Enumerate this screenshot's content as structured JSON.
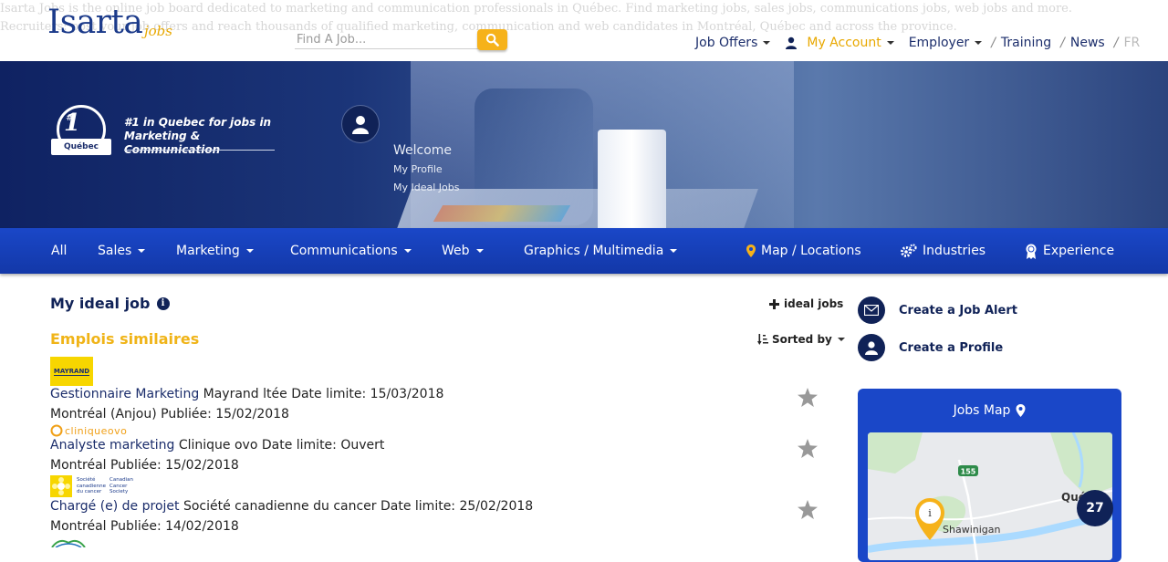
{
  "header": {
    "ghost_text_1": "Isarta Jobs is the online job board dedicated to marketing and communication professionals in Québec. Find marketing jobs, sales jobs, communications jobs, web jobs and more.",
    "ghost_text_2": "Recruiters: post your job offers and reach thousands of qualified marketing, communication and web candidates in Montréal, Québec and across the province.",
    "logo": "Isarta",
    "logo_sub": "jobs",
    "search_placeholder": "Find A Job...",
    "nav": {
      "job_offers": "Job Offers",
      "my_account": "My Account",
      "employer": "Employer",
      "training": "Training",
      "news": "News",
      "lang": "FR",
      "slash": "/"
    }
  },
  "hero": {
    "badge_hash": "#",
    "badge_number": "1",
    "badge_ribbon": "Québec",
    "tagline": "#1 in Quebec for jobs in Marketing & Communication",
    "welcome": "Welcome",
    "my_profile": "My Profile",
    "my_ideal_jobs": "My Ideal Jobs"
  },
  "main_nav": {
    "all": "All",
    "sales": "Sales",
    "marketing": "Marketing",
    "communications": "Communications",
    "web": "Web",
    "graphics": "Graphics / Multimedia",
    "map": "Map / Locations",
    "industries": "Industries",
    "experience": "Experience"
  },
  "content": {
    "my_ideal_job": "My ideal job",
    "info": "i",
    "similar_jobs": "Emplois similaires",
    "add_ideal_jobs": "ideal jobs",
    "sorted_by": "Sorted by"
  },
  "jobs": [
    {
      "logo_text": "MAYRAND",
      "title": "Gestionnaire Marketing",
      "details": " Mayrand ltée Date limite: 15/03/2018",
      "location": "Montréal (Anjou) Publiée: 15/02/2018"
    },
    {
      "logo_text": "cliniqueovo",
      "title": "Analyste marketing",
      "details": " Clinique ovo Date limite: Ouvert",
      "location": "Montréal Publiée: 15/02/2018"
    },
    {
      "logo_text_fr": "Société canadienne du cancer",
      "logo_text_en": "Canadian Cancer Society",
      "title": "Chargé (e) de projet",
      "details": " Société canadienne du cancer Date limite: 25/02/2018",
      "location": "Montréal Publiée: 14/02/2018"
    }
  ],
  "sidebar": {
    "create_alert": "Create a Job Alert",
    "create_profile": "Create a Profile",
    "jobs_map": "Jobs Map",
    "map_labels": {
      "route": "155",
      "city": "Shawinigan",
      "city2": "Qué",
      "marker": "i",
      "cluster_count": "27"
    }
  },
  "colors": {
    "brand_navy": "#102257",
    "brand_blue": "#1a47c8",
    "accent_yellow": "#f0b418"
  }
}
